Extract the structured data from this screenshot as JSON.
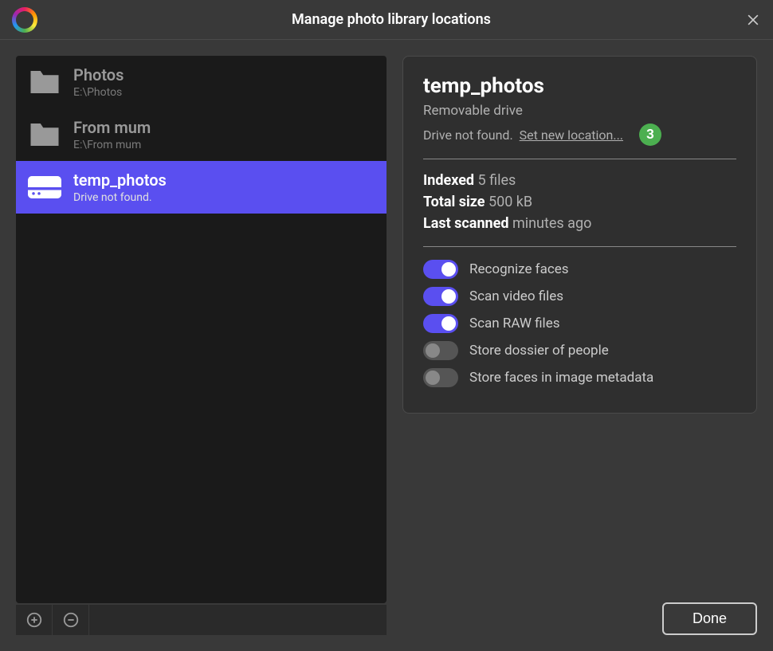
{
  "window": {
    "title": "Manage photo library locations"
  },
  "locations": [
    {
      "name": "Photos",
      "path": "E:\\Photos"
    },
    {
      "name": "From mum",
      "path": "E:\\From mum"
    },
    {
      "name": "temp_photos",
      "path": "Drive not found."
    }
  ],
  "detail": {
    "title": "temp_photos",
    "subtitle": "Removable drive",
    "status": "Drive not found.",
    "link": "Set new location...",
    "badge": "3",
    "indexed_label": "Indexed",
    "indexed_value": "5 files",
    "size_label": "Total size",
    "size_value": "500 kB",
    "scanned_label": "Last scanned",
    "scanned_value": "minutes ago"
  },
  "toggles": [
    {
      "label": "Recognize faces",
      "on": true
    },
    {
      "label": "Scan video files",
      "on": true
    },
    {
      "label": "Scan RAW files",
      "on": true
    },
    {
      "label": "Store dossier of people",
      "on": false
    },
    {
      "label": "Store faces in image metadata",
      "on": false
    }
  ],
  "buttons": {
    "done": "Done"
  }
}
